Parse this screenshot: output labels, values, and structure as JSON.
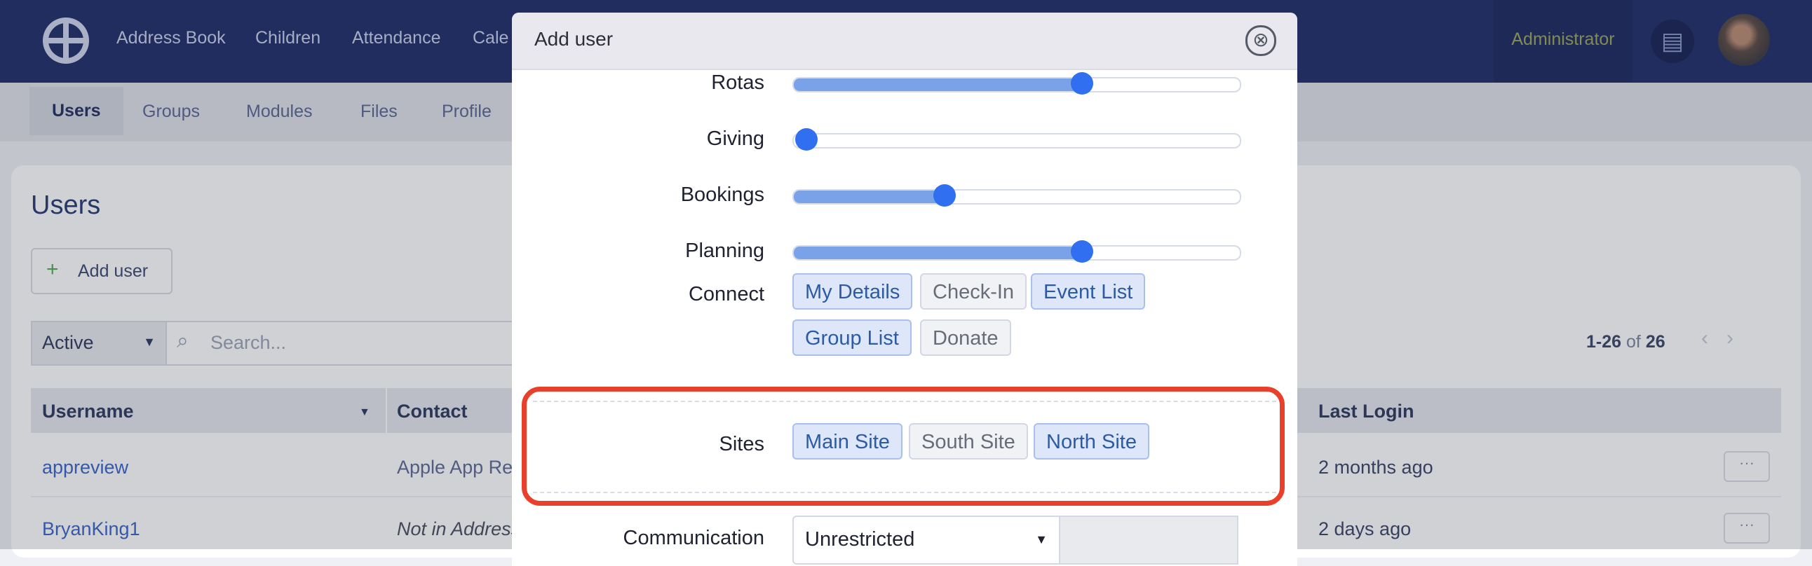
{
  "topnav": {
    "items": [
      "Address Book",
      "Children",
      "Attendance",
      "Cale"
    ],
    "admin_label": "Administrator",
    "building_icon": "building-icon",
    "colors": {
      "bar": "#1f2d6a",
      "admin_text": "#9aa65a"
    }
  },
  "subnav": {
    "tabs": [
      "Users",
      "Groups",
      "Modules",
      "Files",
      "Profile"
    ]
  },
  "page": {
    "title": "Users",
    "add_button": "Add user",
    "filter_value": "Active",
    "search_placeholder": "Search...",
    "pager": {
      "range": "1-26",
      "of_word": "of",
      "total": "26"
    },
    "columns": [
      "Username",
      "Contact",
      "Last Login"
    ],
    "rows": [
      {
        "username": "appreview",
        "contact": "Apple App Re",
        "last_login": "2 months ago"
      },
      {
        "username": "BryanKing1",
        "contact": "Not in Address",
        "last_login": "2 days ago"
      }
    ],
    "row_action": "···"
  },
  "modal": {
    "title": "Add user",
    "close_icon": "⊗",
    "permissions": [
      {
        "label": "Rotas",
        "level": 0.66
      },
      {
        "label": "Giving",
        "level": 0.0
      },
      {
        "label": "Bookings",
        "level": 0.33
      },
      {
        "label": "Planning",
        "level": 0.66
      }
    ],
    "connect": {
      "label": "Connect",
      "options": [
        {
          "label": "My Details",
          "selected": true
        },
        {
          "label": "Check-In",
          "selected": false
        },
        {
          "label": "Event List",
          "selected": true
        },
        {
          "label": "Group List",
          "selected": true
        },
        {
          "label": "Donate",
          "selected": false
        }
      ]
    },
    "sites": {
      "label": "Sites",
      "options": [
        {
          "label": "Main Site",
          "selected": true
        },
        {
          "label": "South Site",
          "selected": false
        },
        {
          "label": "North Site",
          "selected": true
        }
      ]
    },
    "communication": {
      "label": "Communication",
      "value": "Unrestricted"
    }
  },
  "annotation": {
    "highlight_color": "#e8402a"
  }
}
